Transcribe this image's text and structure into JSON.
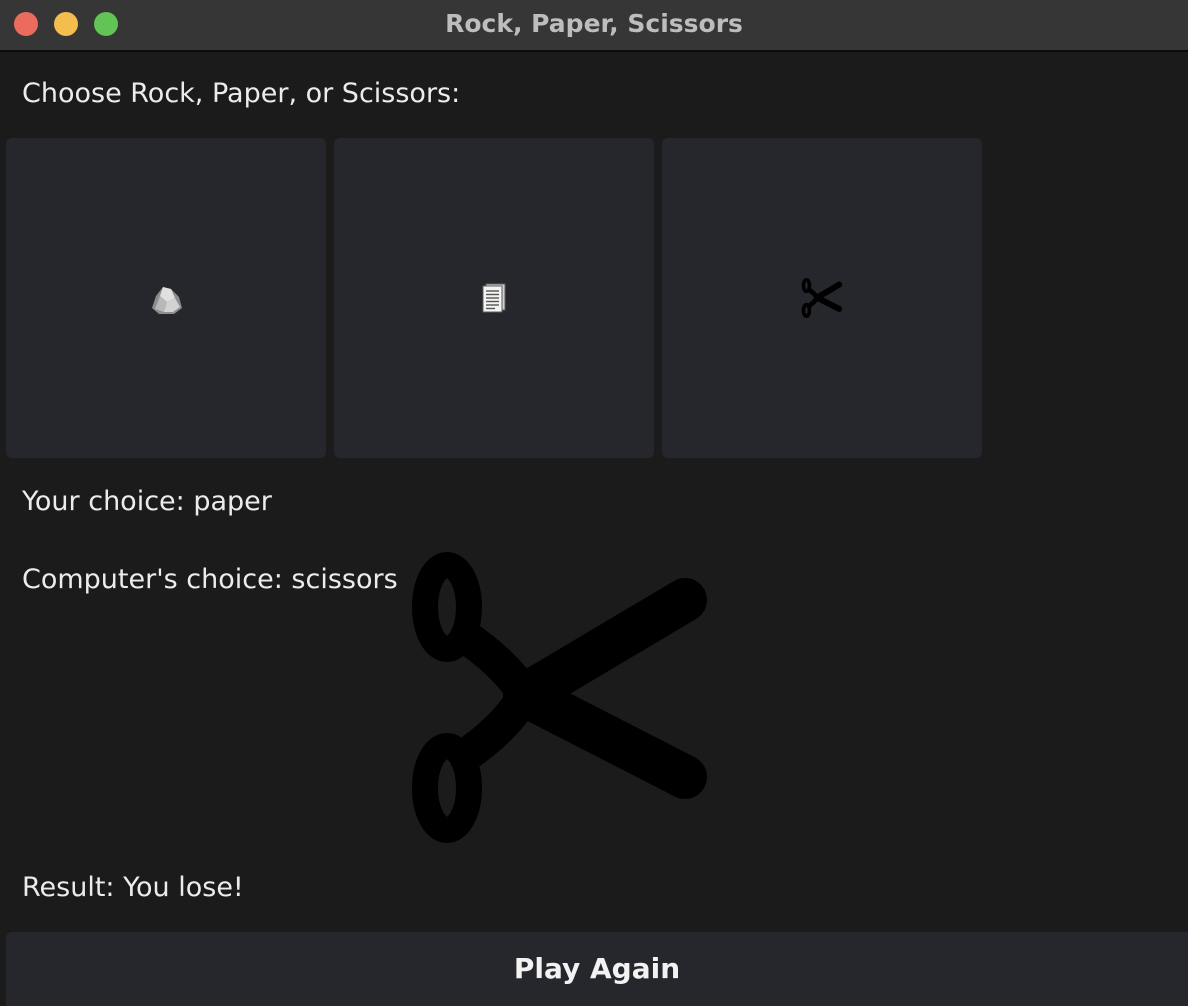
{
  "window": {
    "title": "Rock, Paper, Scissors"
  },
  "prompt": "Choose Rock, Paper, or Scissors:",
  "choices": [
    {
      "icon": "rock-icon"
    },
    {
      "icon": "paper-icon"
    },
    {
      "icon": "scissors-icon"
    }
  ],
  "status": {
    "your_choice": "Your choice: paper",
    "computer_choice": "Computer's choice: scissors",
    "computer_choice_image": "scissors-icon",
    "result": "Result: You lose!"
  },
  "play_again_label": "Play Again"
}
